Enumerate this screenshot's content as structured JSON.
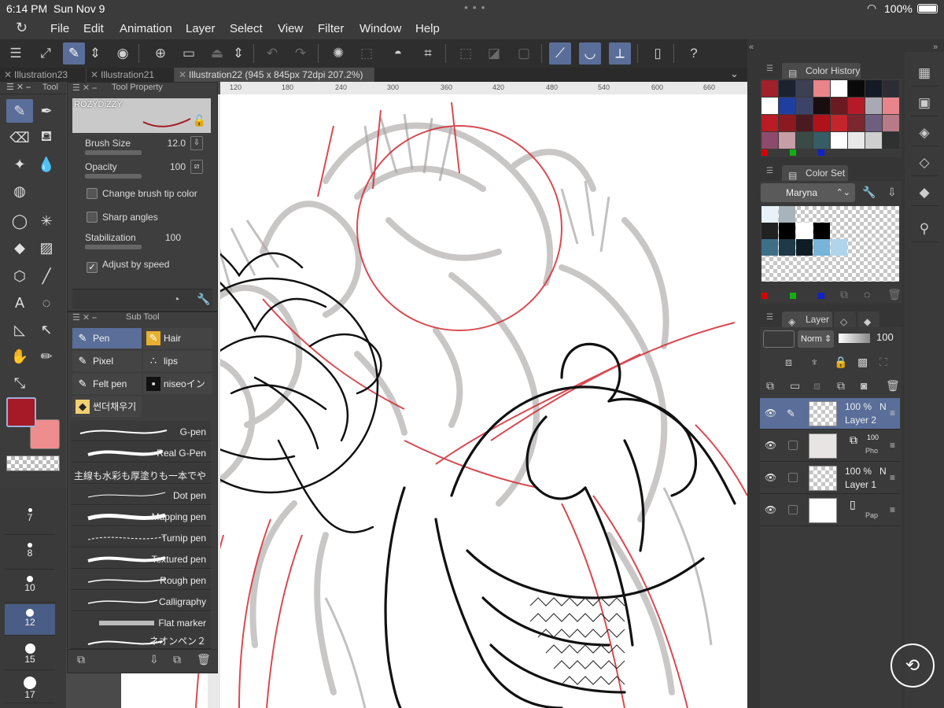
{
  "status_bar": {
    "time": "6:14 PM",
    "date": "Sun Nov 9",
    "battery": "100%"
  },
  "menu": [
    "File",
    "Edit",
    "Animation",
    "Layer",
    "Select",
    "View",
    "Filter",
    "Window",
    "Help"
  ],
  "tabs": [
    {
      "label": "Illustration23"
    },
    {
      "label": "Illustration21"
    },
    {
      "label": "Illustration22 (945 x 845px 72dpi 207.2%)"
    }
  ],
  "ruler": [
    "120",
    "180",
    "240",
    "300",
    "360",
    "420",
    "480",
    "540",
    "600",
    "660"
  ],
  "tool_panel": {
    "title": "Tool"
  },
  "tool_property": {
    "title": "Tool Property",
    "brush_name": "ROZYDiZZY",
    "brush_size_label": "Brush Size",
    "brush_size_value": "12.0",
    "opacity_label": "Opacity",
    "opacity_value": "100",
    "change_tip_color": "Change brush tip color",
    "sharp_angles": "Sharp angles",
    "stabilization_label": "Stabilization",
    "stabilization_value": "100",
    "adjust_by_speed": "Adjust by speed"
  },
  "sub_tool": {
    "title": "Sub Tool",
    "groups": [
      "Pen",
      "Hair",
      "Pixel",
      "lips",
      "Felt pen",
      "niseoインク",
      "썬더채우기판"
    ],
    "brushes": [
      "G-pen",
      "Real G-Pen",
      "主線も水彩も厚塗りも一本でや",
      "Dot pen",
      "Mapping pen",
      "Turnip pen",
      "Textured pen",
      "Rough pen",
      "Calligraphy",
      "Flat marker",
      "ネオンペン２"
    ]
  },
  "brush_sizes": [
    "7",
    "8",
    "10",
    "12",
    "15",
    "17"
  ],
  "colors": {
    "main": "#a51a25",
    "sub": "#ef8c8d",
    "accent": "#5a6e99",
    "history": [
      "#a0202c",
      "#1c2230",
      "#3b4052",
      "#e8848a",
      "#ffffff",
      "#0a0a0a",
      "#141a26",
      "#2c2c34",
      "#ffffff",
      "#1f3fa0",
      "#3b4468",
      "#1a0d10",
      "#6b1a22",
      "#b51a26",
      "#a9a9b3",
      "#e9848c",
      "#b91c24",
      "#8a1a1f",
      "#4a1a20",
      "#b0121a",
      "#c4242c",
      "#7c2630",
      "#6e5e80",
      "#b87a86",
      "#8e4a6a",
      "#c79da6",
      "#3a4a44",
      "#365c66",
      "#ffffff",
      "#e8e8e8",
      "#cfcfcf",
      "#2f3030"
    ],
    "color_set": [
      "#e8f2f8",
      "#a8b4bc",
      "#222222",
      "#000000",
      "#ffffff",
      "#000000",
      "#3f6f88",
      "#1e3a48",
      "#0e1c24",
      "#78b4d8",
      "#b0d4ec"
    ]
  },
  "color_history": {
    "title": "Color History"
  },
  "color_set": {
    "title": "Color Set",
    "set_name": "Maryna"
  },
  "layer_panel": {
    "title": "Layer",
    "blend_mode": "Norm",
    "opacity": "100",
    "layers": [
      {
        "pct": "100 %",
        "name": "Layer 2",
        "suffix": "N"
      },
      {
        "pct": "100",
        "name": "Pho"
      },
      {
        "pct": "100 %",
        "name": "Layer 1",
        "suffix": "N"
      },
      {
        "pct": "",
        "name": "Pap"
      }
    ]
  },
  "icons": [
    "pen-icon",
    "eraser-icon",
    "hand-icon",
    "eyedropper-icon",
    "layer-icon",
    "gear-icon"
  ]
}
